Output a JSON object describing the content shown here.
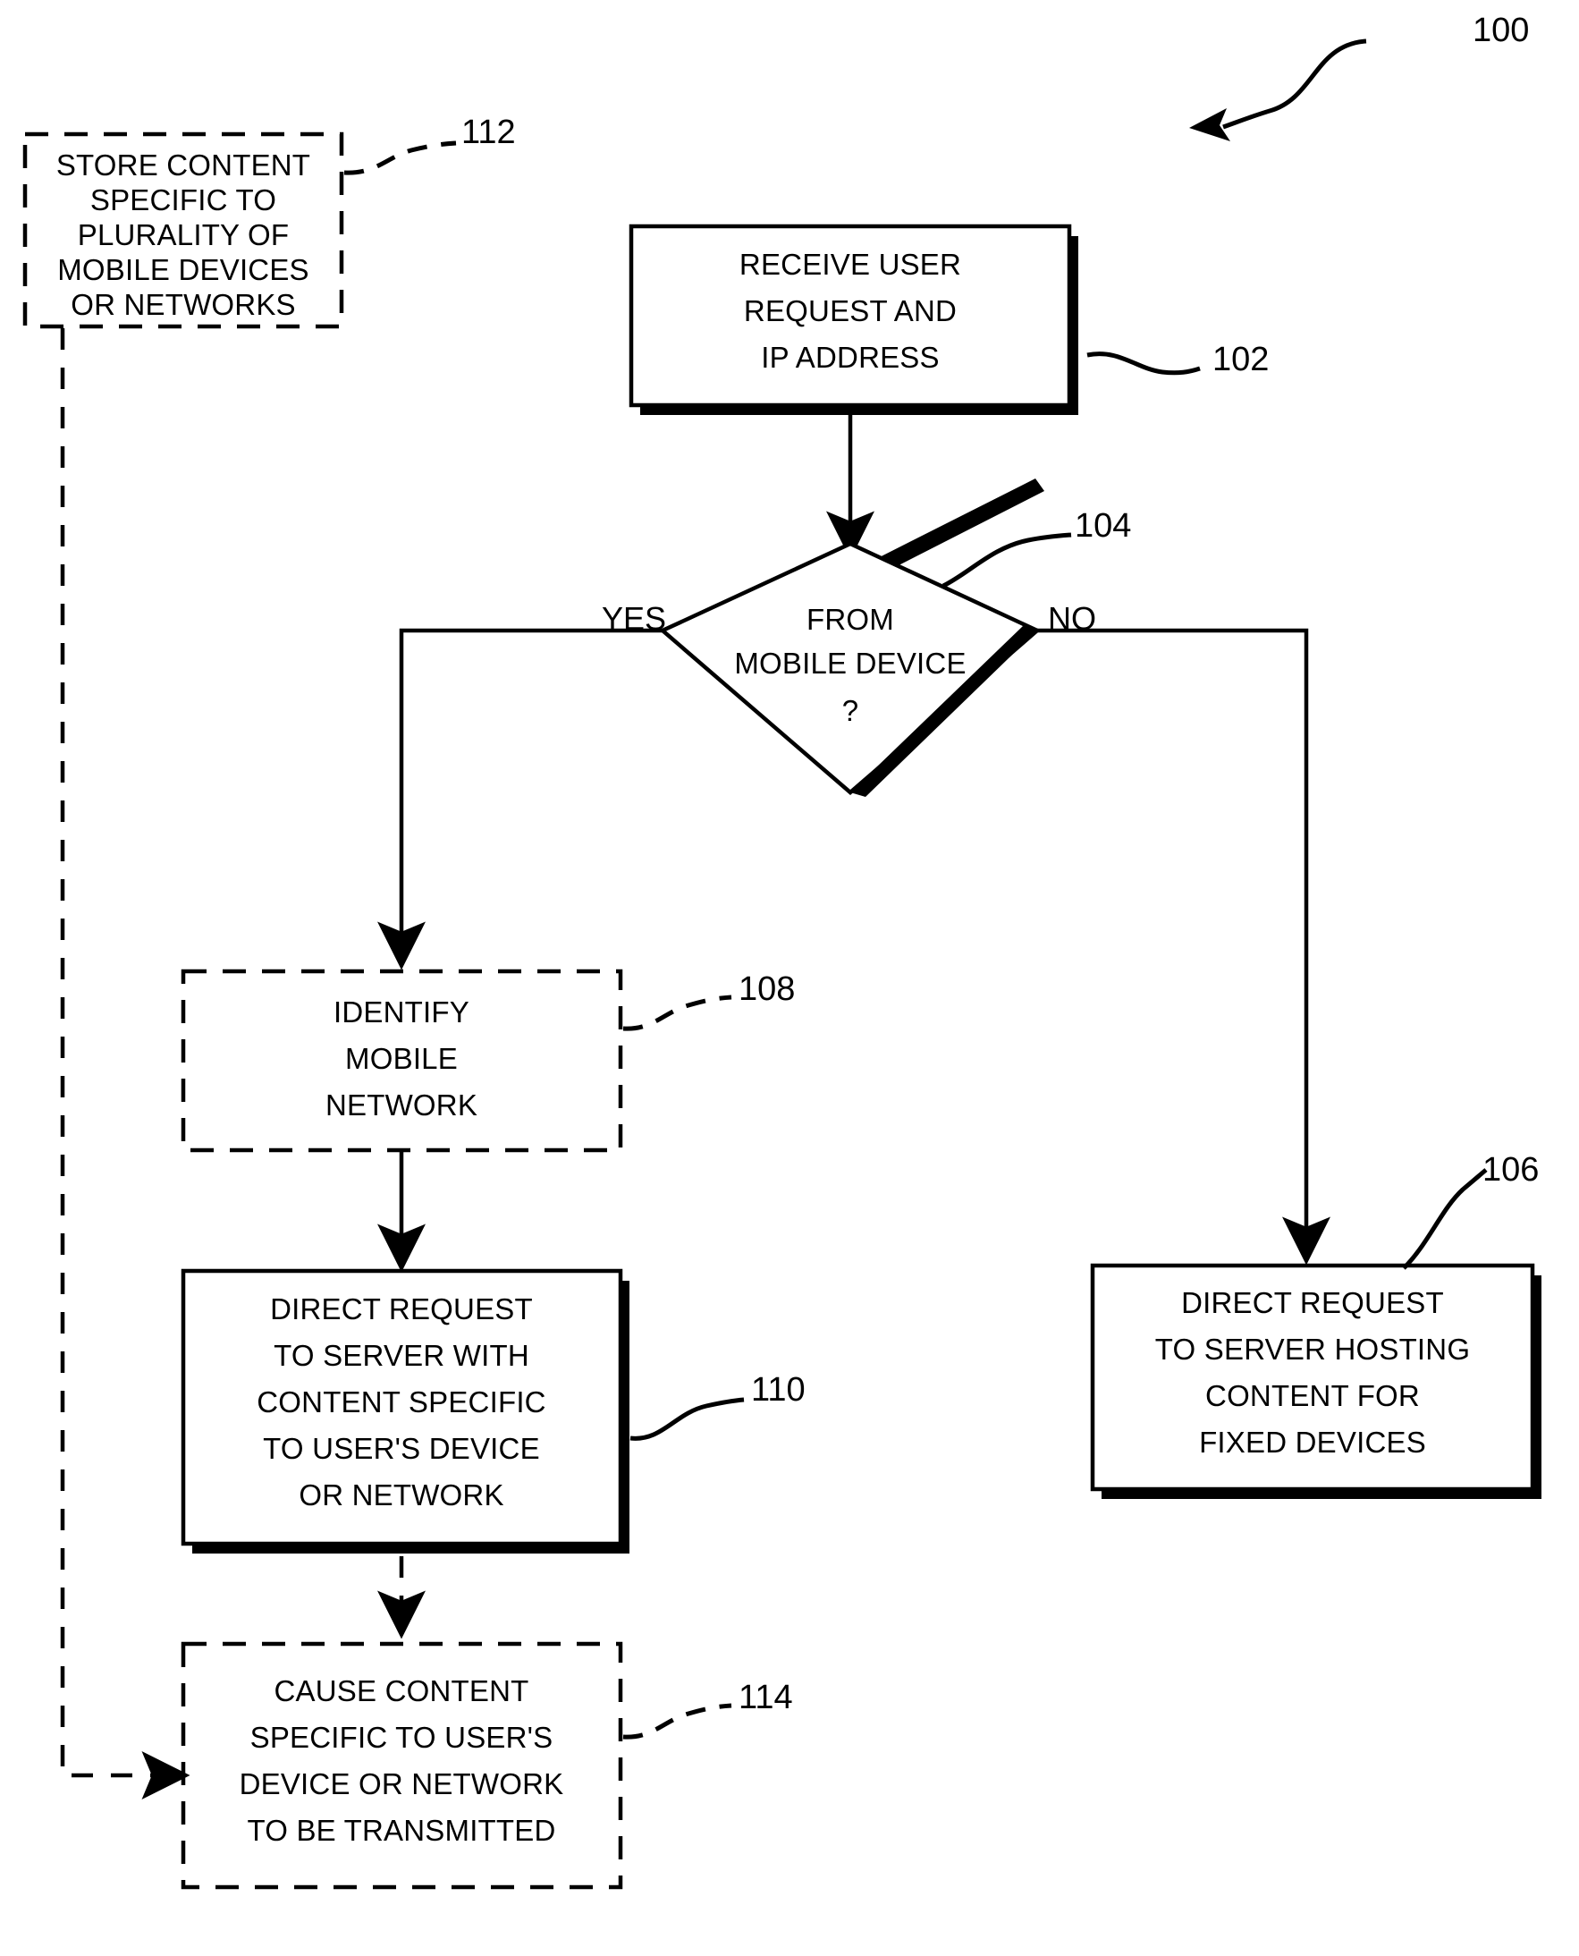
{
  "figure": {
    "reference_numeral": "100",
    "type": "patent-flowchart"
  },
  "nodes": [
    {
      "id": "n112",
      "ref": "112",
      "style": "dashed",
      "lines": [
        "STORE CONTENT",
        "SPECIFIC TO",
        "PLURALITY OF",
        "MOBILE DEVICES",
        "OR NETWORKS"
      ]
    },
    {
      "id": "n102",
      "ref": "102",
      "style": "solid-shadow",
      "lines": [
        "RECEIVE USER",
        "REQUEST AND",
        "IP ADDRESS"
      ]
    },
    {
      "id": "n104",
      "ref": "104",
      "style": "diamond-shadow",
      "lines": [
        "FROM",
        "MOBILE DEVICE",
        "?"
      ]
    },
    {
      "id": "n108",
      "ref": "108",
      "style": "dashed",
      "lines": [
        "IDENTIFY",
        "MOBILE",
        "NETWORK"
      ]
    },
    {
      "id": "n110",
      "ref": "110",
      "style": "solid-shadow",
      "lines": [
        "DIRECT REQUEST",
        "TO SERVER WITH",
        "CONTENT SPECIFIC",
        "TO USER'S DEVICE",
        "OR NETWORK"
      ]
    },
    {
      "id": "n106",
      "ref": "106",
      "style": "solid-shadow",
      "lines": [
        "DIRECT REQUEST",
        "TO SERVER HOSTING",
        "CONTENT FOR",
        "FIXED DEVICES"
      ]
    },
    {
      "id": "n114",
      "ref": "114",
      "style": "dashed",
      "lines": [
        "CAUSE CONTENT",
        "SPECIFIC TO USER'S",
        "DEVICE OR NETWORK",
        "TO BE TRANSMITTED"
      ]
    }
  ],
  "branch_labels": {
    "yes": "YES",
    "no": "NO"
  },
  "colors": {
    "stroke": "#000000",
    "fill": "#ffffff",
    "background": "#ffffff"
  },
  "chart_data": {
    "type": "diagram",
    "title": "",
    "nodes": [
      {
        "ref": "112",
        "label": "STORE CONTENT SPECIFIC TO PLURALITY OF MOBILE DEVICES OR NETWORKS",
        "shape": "rect",
        "border": "dashed"
      },
      {
        "ref": "102",
        "label": "RECEIVE USER REQUEST AND IP ADDRESS",
        "shape": "rect",
        "border": "solid"
      },
      {
        "ref": "104",
        "label": "FROM MOBILE DEVICE ?",
        "shape": "diamond",
        "border": "solid"
      },
      {
        "ref": "108",
        "label": "IDENTIFY MOBILE NETWORK",
        "shape": "rect",
        "border": "dashed"
      },
      {
        "ref": "110",
        "label": "DIRECT REQUEST TO SERVER WITH CONTENT SPECIFIC TO USER'S DEVICE OR NETWORK",
        "shape": "rect",
        "border": "solid"
      },
      {
        "ref": "106",
        "label": "DIRECT REQUEST TO SERVER HOSTING CONTENT FOR FIXED DEVICES",
        "shape": "rect",
        "border": "solid"
      },
      {
        "ref": "114",
        "label": "CAUSE CONTENT SPECIFIC TO USER'S DEVICE OR NETWORK TO BE TRANSMITTED",
        "shape": "rect",
        "border": "dashed"
      }
    ],
    "edges": [
      {
        "from": "102",
        "to": "104",
        "label": "",
        "style": "solid"
      },
      {
        "from": "104",
        "to": "108",
        "label": "YES",
        "style": "solid"
      },
      {
        "from": "104",
        "to": "106",
        "label": "NO",
        "style": "solid"
      },
      {
        "from": "108",
        "to": "110",
        "label": "",
        "style": "solid"
      },
      {
        "from": "110",
        "to": "114",
        "label": "",
        "style": "dashed"
      },
      {
        "from": "112",
        "to": "114",
        "label": "",
        "style": "dashed"
      }
    ]
  }
}
